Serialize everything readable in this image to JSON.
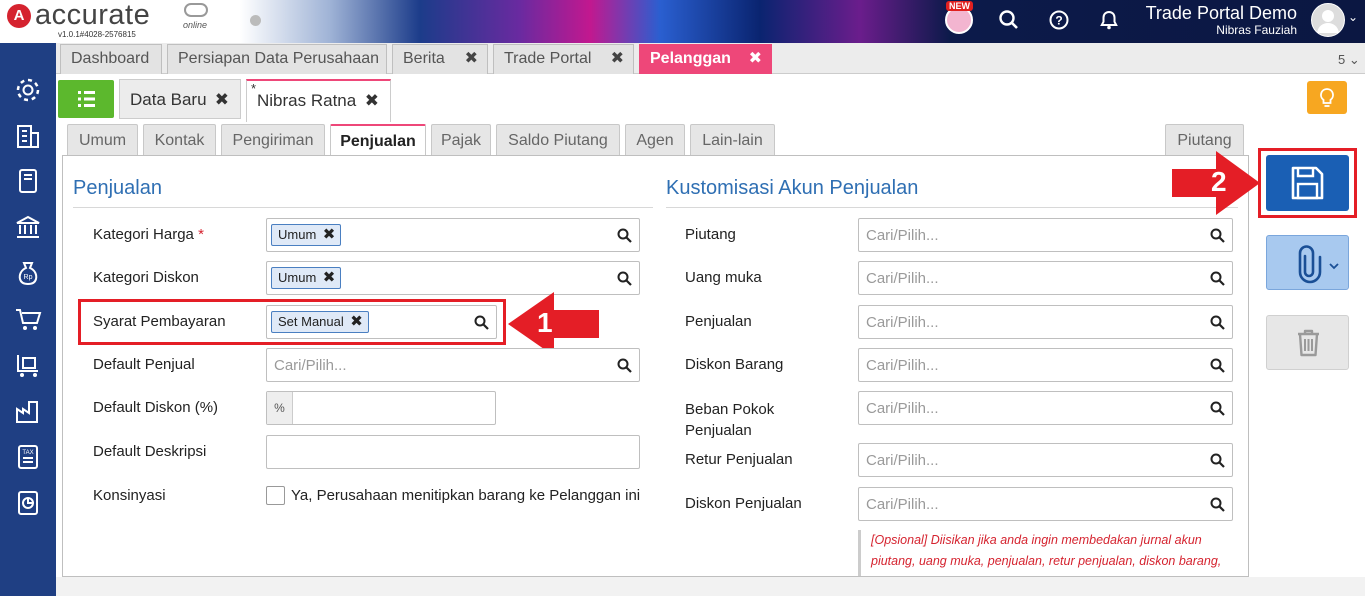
{
  "brand": {
    "logo_mark": "A",
    "name": "accurate",
    "suffix": "online",
    "version": "v1.0.1#4028-2576815"
  },
  "topbar": {
    "new_badge": "NEW",
    "company": "Trade Portal Demo",
    "user": "Nibras Fauziah"
  },
  "main_tabs": [
    {
      "label": "Dashboard",
      "closable": false
    },
    {
      "label": "Persiapan Data Perusahaan",
      "closable": false
    },
    {
      "label": "Berita",
      "closable": true
    },
    {
      "label": "Trade Portal",
      "closable": true
    },
    {
      "label": "Pelanggan",
      "closable": true,
      "active": true
    }
  ],
  "tab_count": "5",
  "sub_tabs": [
    {
      "label": "Data Baru"
    },
    {
      "label": "Nibras Ratna",
      "modified_mark": "*",
      "active": true
    }
  ],
  "form_tabs": [
    "Umum",
    "Kontak",
    "Pengiriman",
    "Penjualan",
    "Pajak",
    "Saldo Piutang",
    "Agen",
    "Lain-lain",
    "Piutang"
  ],
  "active_form_tab": "Penjualan",
  "penjualan": {
    "title": "Penjualan",
    "kategori_harga": {
      "label": "Kategori Harga",
      "required": "*",
      "value": "Umum"
    },
    "kategori_diskon": {
      "label": "Kategori Diskon",
      "value": "Umum"
    },
    "syarat_pembayaran": {
      "label": "Syarat Pembayaran",
      "value": "Set Manual"
    },
    "default_penjual": {
      "label": "Default Penjual",
      "placeholder": "Cari/Pilih..."
    },
    "default_diskon": {
      "label": "Default Diskon (%)",
      "unit": "%"
    },
    "default_deskripsi": {
      "label": "Default Deskripsi"
    },
    "konsinyasi": {
      "label": "Konsinyasi",
      "checkbox_label": "Ya, Perusahaan menitipkan barang ke Pelanggan ini"
    }
  },
  "kustomisasi": {
    "title": "Kustomisasi Akun Penjualan",
    "placeholder": "Cari/Pilih...",
    "fields": [
      "Piutang",
      "Uang muka",
      "Penjualan",
      "Diskon Barang",
      "Beban Pokok Penjualan",
      "Retur Penjualan",
      "Diskon Penjualan"
    ],
    "hint": "[Opsional] Diisikan jika anda ingin membedakan jurnal akun piutang, uang muka, penjualan, retur penjualan, diskon barang, penjualan dan beban pokok penjualan untuk pelanggan ini."
  },
  "annotations": {
    "step1": "1",
    "step2": "2"
  }
}
